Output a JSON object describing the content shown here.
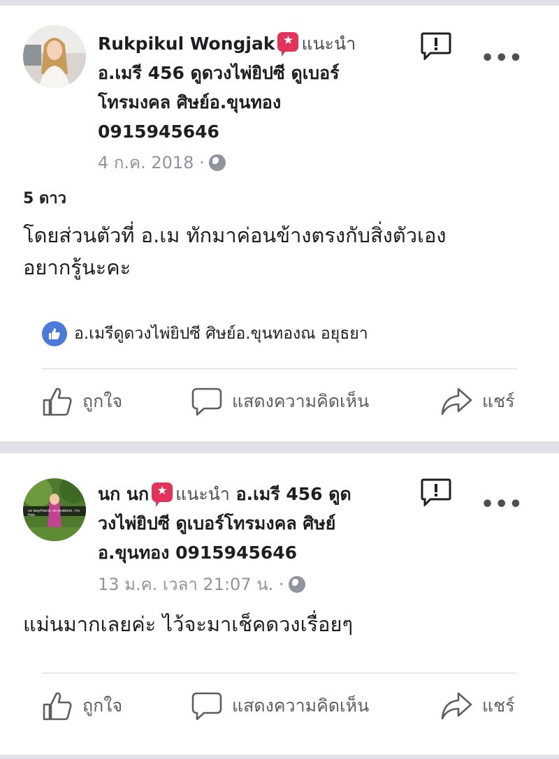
{
  "posts": [
    {
      "author": "Rukpikul Wongjak",
      "recommends": "แนะนำ",
      "page_line1": "อ.เมรี 456 ดูดวงไพ่ยิปซี ดูเบอร์",
      "page_line2": "โทรมงคล ศิษย์อ.ขุนทอง",
      "page_line3": "0915945646",
      "date": "4 ก.ค. 2018 ·",
      "rating": "5 ดาว",
      "text_line1": "โดยส่วนตัวที่ อ.เม ทักมาค่อนข้างตรงกับสิ่งตัวเอง",
      "text_line2": "อยากรู้นะคะ",
      "liked_by": "อ.เมรีดูดวงไพ่ยิปซี ศิษย์อ.ขุนทองณ อยุธยา",
      "actions": {
        "like": "ถูกใจ",
        "comment": "แสดงความคิดเห็น",
        "share": "แชร์"
      }
    },
    {
      "author": "นก นก",
      "recommends": "แนะนำ",
      "page_line1": "อ.เมรี 456 ดูด",
      "page_line2": "วงไพ่ยิปซี ดูเบอร์โทรมงคล ศิษย์",
      "page_line3": "อ.ขุนทอง 0915945646",
      "date": "13 ม.ค. เวลา 21:07 น. ·",
      "avatar_caption": "no boyfriend, no problem, i'm free",
      "text_line1": "แม่นมากเลยค่ะ ไว้จะมาเช็คดวงเรื่อยๆ",
      "actions": {
        "like": "ถูกใจ",
        "comment": "แสดงความคิดเห็น",
        "share": "แชร์"
      }
    }
  ],
  "more_label": "•••",
  "colors": {
    "badge": "#e4335b",
    "like_blue": "#4a7bd9",
    "meta_gray": "#90949c"
  }
}
